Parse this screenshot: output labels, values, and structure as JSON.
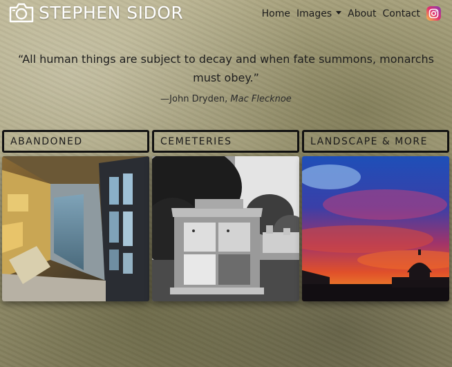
{
  "brand": {
    "name": "STEPHEN SIDOR",
    "logo_icon": "camera-icon"
  },
  "nav": {
    "home": "Home",
    "images": "Images",
    "about": "About",
    "contact": "Contact",
    "social_icon": "instagram-icon"
  },
  "quote": {
    "text": "“All human things are subject to decay and when fate summons, monarchs must obey.”",
    "author": "—John Dryden,",
    "work": "Mac Flecknoe"
  },
  "galleries": [
    {
      "label": "ABANDONED"
    },
    {
      "label": "CEMETERIES"
    },
    {
      "label": "LANDSCAPE & MORE"
    }
  ],
  "colors": {
    "text": "#1c1c1c",
    "brand_text": "#ffffff",
    "card_border": "#111111"
  }
}
